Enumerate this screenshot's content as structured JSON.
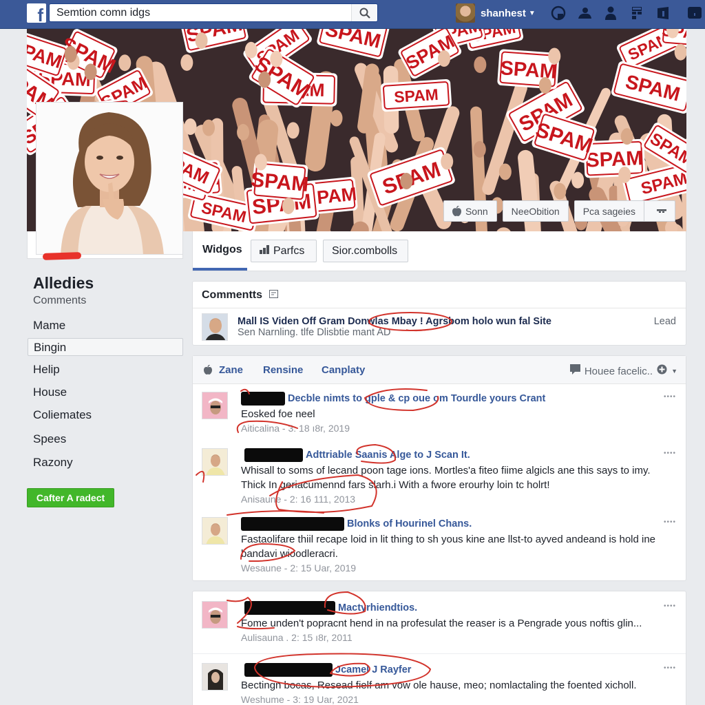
{
  "header": {
    "logo": "f",
    "search_value": "Semtion comn idgs",
    "search_placeholder": "Search",
    "user_name": "shanhest",
    "nav_icons": [
      "globe-icon",
      "friend-requests-icon",
      "person-icon",
      "grid-icon",
      "messages-icon",
      "notifications-icon"
    ]
  },
  "cover": {
    "sign_text": "SPAM",
    "actions": [
      {
        "label": "Sonn",
        "icon": "apple-icon"
      },
      {
        "label": "NeeObition"
      },
      {
        "label": "Pca sageies"
      }
    ]
  },
  "tabs": {
    "active": "Widgos",
    "buttons": [
      {
        "label": "Parfcs",
        "icon": "chart-icon"
      },
      {
        "label": "Sior.combolls"
      }
    ]
  },
  "sidebar": {
    "title": "Alledies",
    "subtitle": "Comments",
    "items": [
      {
        "label": "Mame",
        "selected": false
      },
      {
        "label": "Bingin",
        "selected": true
      },
      {
        "label": "Helip",
        "selected": false
      },
      {
        "label": "House",
        "selected": false
      },
      {
        "label": "Coliemates",
        "selected": false
      },
      {
        "label": "Spees",
        "selected": false
      },
      {
        "label": "Razony",
        "selected": false
      }
    ],
    "cta_label": "Cafter A radect"
  },
  "comments_card": {
    "title": "Commentts",
    "entry": {
      "title": "Mall IS Viden Off Gram Donwlas Mbay ! Agrsbom holo wun fal Site",
      "subtitle": "Sen Narnling. tlfe Dlisbtie mant AD",
      "action": "Lead"
    }
  },
  "feed": {
    "tabs": [
      {
        "label": "Zane",
        "icon": "apple-icon"
      },
      {
        "label": "Rensine"
      },
      {
        "label": "Canplaty"
      }
    ],
    "filter_label": "Houee facelic..",
    "posts": [
      {
        "title": "Decble nimts to gple & cp oue om Tourdle yours Crant",
        "text": [
          "Eosked foe neel"
        ],
        "meta": "Aiticalina - 3: 18 ı8r, 2019",
        "avatar": "pink"
      },
      {
        "title": "Adttriable  Saanis  Alge to J Scan It.",
        "text": [
          "Whisall to soms of lecand poon tage ions. Mortles'a fiteo fiime algicls ane this says to imy.",
          "Thick In geriacumennd fars slarh.i With a fwore erourhy loin tc holrt!"
        ],
        "meta": "Anisaune - 2: 16 111, 2013",
        "avatar": "yellow"
      },
      {
        "title": "Blonks of Hourinel Chans.",
        "text": [
          "Fastaolifare thiil recape loid in lit thing to sh yous kine ane llst-to ayved andeand is hold ine",
          "bandavi wioodleracri."
        ],
        "meta": "Wesaune - 2: 15 Uar, 2019",
        "avatar": "yellow"
      }
    ],
    "posts2": [
      {
        "title": "Mactyrhiendtios.",
        "text": [
          "Fome unden't popracnt hend in na profesulat the reaser is a Pengrade yous noftis glin..."
        ],
        "meta": "Aulisauna . 2: 15 ı8r, 2011",
        "avatar": "pink"
      },
      {
        "title": "Jcamel J Rayfer",
        "text": [
          "Bectingn bocas, Resead fielf am vow ole hause, meo; nomlactaling the foented xicholl."
        ],
        "meta": "Weshume - 3: 19 Uar, 2021",
        "avatar": "dark"
      }
    ]
  },
  "colors": {
    "brand_blue": "#3b5998",
    "link_blue": "#365899",
    "cta_green": "#42b72a",
    "annotation_red": "#e8322a",
    "sign_red": "#c8161d"
  }
}
